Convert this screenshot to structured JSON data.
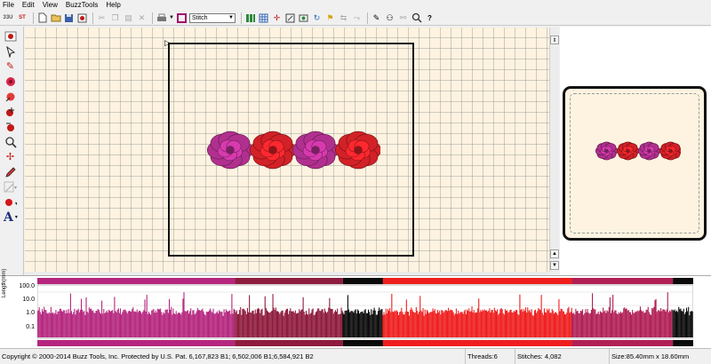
{
  "menu": [
    "File",
    "Edit",
    "View",
    "BuzzTools",
    "Help"
  ],
  "toolbar": {
    "left_text_buttons": [
      "33U",
      "ST"
    ],
    "mode_select": "Stitch",
    "icons": [
      "new-file-icon",
      "open-folder-icon",
      "save-icon",
      "record-icon",
      "cut-icon",
      "copy-icon",
      "paste-icon",
      "delete-icon",
      "print-icon",
      "hoop-icon",
      "thread-colors-icon",
      "grid-icon",
      "center-icon",
      "resize-icon",
      "view-icon",
      "rotate-icon",
      "flag-icon",
      "flip-icon",
      "branch-icon",
      "stitch-icon",
      "combine-icon",
      "split-icon",
      "zoom-icon",
      "help-icon"
    ]
  },
  "palette": {
    "tools": [
      "trace-tool-icon",
      "select-tool-icon",
      "stitch-tool-icon",
      "rose-tool-icon",
      "reshape-tool-icon",
      "fill-tool-icon",
      "satin-tool-icon",
      "zoom-tool-icon",
      "move-tool-icon",
      "pen-tool-icon",
      "shape-tool-icon",
      "color-tool-icon",
      "text-tool-icon"
    ],
    "text_tool_glyph": "A"
  },
  "canvas": {
    "background": "#fdf3e0",
    "grid_color": "#c8c8c8"
  },
  "design": {
    "roses": [
      {
        "color": "#c0349b"
      },
      {
        "color": "#e4242a"
      },
      {
        "color": "#c0349b"
      },
      {
        "color": "#e4242a"
      }
    ]
  },
  "graph": {
    "y_ticks": [
      "100.0",
      "10.0",
      "1.0",
      "0.1"
    ],
    "y_title": "Length(mm)",
    "bands": [
      {
        "color": "#b5267e",
        "fraction": 0.301
      },
      {
        "color": "#8e1c3e",
        "fraction": 0.165
      },
      {
        "color": "#0a0a0a",
        "fraction": 0.061
      },
      {
        "color": "#ef1e1e",
        "fraction": 0.288
      },
      {
        "color": "#b12055",
        "fraction": 0.154
      },
      {
        "color": "#0a0a0a",
        "fraction": 0.031
      }
    ]
  },
  "status": {
    "copyright": "Copyright © 2000-2014 Buzz Tools, Inc. Protected by U.S. Pat. 6,167,823 B1; 6,502,006 B1;6,584,921 B2",
    "threads": "Threads:6",
    "stitches": "Stitches: 4,082",
    "size": "Size:85.40mm x 18.60mm"
  }
}
